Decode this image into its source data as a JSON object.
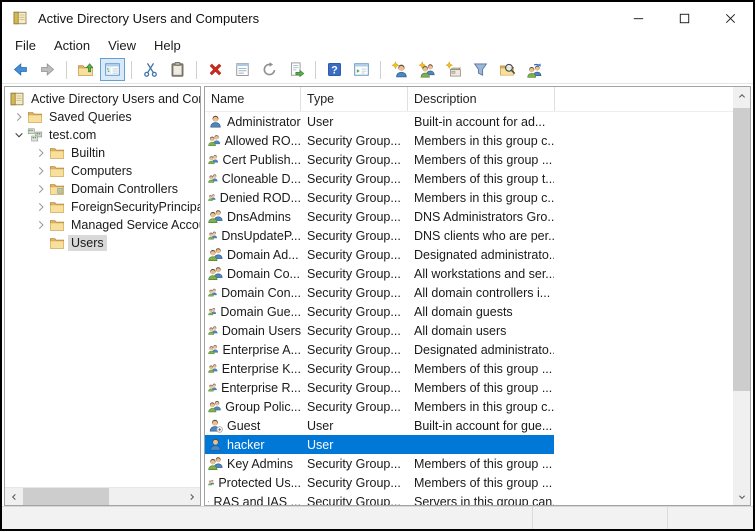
{
  "window": {
    "title": "Active Directory Users and Computers",
    "app_icon": "mmc-console-icon",
    "controls": [
      {
        "icon": "minimize-icon"
      },
      {
        "icon": "maximize-icon"
      },
      {
        "icon": "close-icon"
      }
    ]
  },
  "menubar": {
    "items": [
      {
        "label": "File"
      },
      {
        "label": "Action"
      },
      {
        "label": "View"
      },
      {
        "label": "Help"
      }
    ]
  },
  "toolbar": {
    "items": [
      {
        "icon": "back-icon"
      },
      {
        "icon": "forward-icon"
      },
      "sep",
      {
        "icon": "up-one-level-icon"
      },
      {
        "icon": "show-console-tree-icon",
        "toggled": true
      },
      "sep",
      {
        "icon": "cut-icon"
      },
      {
        "icon": "paste-icon"
      },
      "sep",
      {
        "icon": "delete-icon"
      },
      {
        "icon": "properties-icon"
      },
      {
        "icon": "refresh-icon"
      },
      {
        "icon": "export-list-icon"
      },
      "sep",
      {
        "icon": "help-icon"
      },
      {
        "icon": "console-window-icon"
      },
      "sep",
      {
        "icon": "new-user-icon"
      },
      {
        "icon": "new-group-icon"
      },
      {
        "icon": "new-ou-icon"
      },
      {
        "icon": "filter-icon"
      },
      {
        "icon": "find-icon"
      },
      {
        "icon": "add-to-group-icon"
      }
    ]
  },
  "tree": {
    "items": [
      {
        "label": "Active Directory Users and Computers",
        "level": 0,
        "expander": "none",
        "icon": "console",
        "selected": false
      },
      {
        "label": "Saved Queries",
        "level": 1,
        "expander": "collapsed",
        "icon": "folder",
        "selected": false
      },
      {
        "label": "test.com",
        "level": 1,
        "expander": "expanded",
        "icon": "domain",
        "selected": false
      },
      {
        "label": "Builtin",
        "level": 2,
        "expander": "collapsed",
        "icon": "folder",
        "selected": false
      },
      {
        "label": "Computers",
        "level": 2,
        "expander": "collapsed",
        "icon": "folder",
        "selected": false
      },
      {
        "label": "Domain Controllers",
        "level": 2,
        "expander": "collapsed",
        "icon": "folder-dc",
        "selected": false
      },
      {
        "label": "ForeignSecurityPrincipals",
        "level": 2,
        "expander": "collapsed",
        "icon": "folder",
        "selected": false
      },
      {
        "label": "Managed Service Accounts",
        "level": 2,
        "expander": "collapsed",
        "icon": "folder",
        "selected": false
      },
      {
        "label": "Users",
        "level": 2,
        "expander": "none",
        "icon": "folder",
        "selected": true
      }
    ]
  },
  "list": {
    "columns": [
      {
        "label": "Name"
      },
      {
        "label": "Type"
      },
      {
        "label": "Description"
      }
    ],
    "rows": [
      {
        "name": "Administrator",
        "type": "User",
        "description": "Built-in account for ad...",
        "icon": "user",
        "selected": false
      },
      {
        "name": "Allowed RO...",
        "type": "Security Group...",
        "description": "Members in this group c...",
        "icon": "security-group",
        "selected": false
      },
      {
        "name": "Cert Publish...",
        "type": "Security Group...",
        "description": "Members of this group ...",
        "icon": "security-group",
        "selected": false
      },
      {
        "name": "Cloneable D...",
        "type": "Security Group...",
        "description": "Members of this group t...",
        "icon": "security-group",
        "selected": false
      },
      {
        "name": "Denied ROD...",
        "type": "Security Group...",
        "description": "Members in this group c...",
        "icon": "security-group",
        "selected": false
      },
      {
        "name": "DnsAdmins",
        "type": "Security Group...",
        "description": "DNS Administrators Gro...",
        "icon": "security-group",
        "selected": false
      },
      {
        "name": "DnsUpdateP...",
        "type": "Security Group...",
        "description": "DNS clients who are per...",
        "icon": "security-group",
        "selected": false
      },
      {
        "name": "Domain Ad...",
        "type": "Security Group...",
        "description": "Designated administrato...",
        "icon": "security-group",
        "selected": false
      },
      {
        "name": "Domain Co...",
        "type": "Security Group...",
        "description": "All workstations and ser...",
        "icon": "security-group",
        "selected": false
      },
      {
        "name": "Domain Con...",
        "type": "Security Group...",
        "description": "All domain controllers i...",
        "icon": "security-group",
        "selected": false
      },
      {
        "name": "Domain Gue...",
        "type": "Security Group...",
        "description": "All domain guests",
        "icon": "security-group",
        "selected": false
      },
      {
        "name": "Domain Users",
        "type": "Security Group...",
        "description": "All domain users",
        "icon": "security-group",
        "selected": false
      },
      {
        "name": "Enterprise A...",
        "type": "Security Group...",
        "description": "Designated administrato...",
        "icon": "security-group",
        "selected": false
      },
      {
        "name": "Enterprise K...",
        "type": "Security Group...",
        "description": "Members of this group ...",
        "icon": "security-group",
        "selected": false
      },
      {
        "name": "Enterprise R...",
        "type": "Security Group...",
        "description": "Members of this group ...",
        "icon": "security-group",
        "selected": false
      },
      {
        "name": "Group Polic...",
        "type": "Security Group...",
        "description": "Members in this group c...",
        "icon": "security-group",
        "selected": false
      },
      {
        "name": "Guest",
        "type": "User",
        "description": "Built-in account for gue...",
        "icon": "user-disabled",
        "selected": false
      },
      {
        "name": "hacker",
        "type": "User",
        "description": "",
        "icon": "user",
        "selected": true
      },
      {
        "name": "Key Admins",
        "type": "Security Group...",
        "description": "Members of this group ...",
        "icon": "security-group",
        "selected": false
      },
      {
        "name": "Protected Us...",
        "type": "Security Group...",
        "description": "Members of this group ...",
        "icon": "security-group",
        "selected": false
      },
      {
        "name": "RAS and IAS ...",
        "type": "Security Group...",
        "description": "Servers in this group can...",
        "icon": "security-group",
        "selected": false
      }
    ]
  },
  "statusbar": {
    "text": ""
  },
  "colors": {
    "selection_bg": "#0078d7",
    "selection_text": "#ffffff",
    "tree_selection_bg": "#d9d9d9",
    "toolbar_toggle_bg": "#d8eaf9",
    "toolbar_toggle_border": "#66a0d0",
    "window_border": "#000000",
    "scroll_track": "#f0f0f0",
    "scroll_thumb": "#cdcdcd",
    "statusbar_bg": "#f2f2f2"
  }
}
